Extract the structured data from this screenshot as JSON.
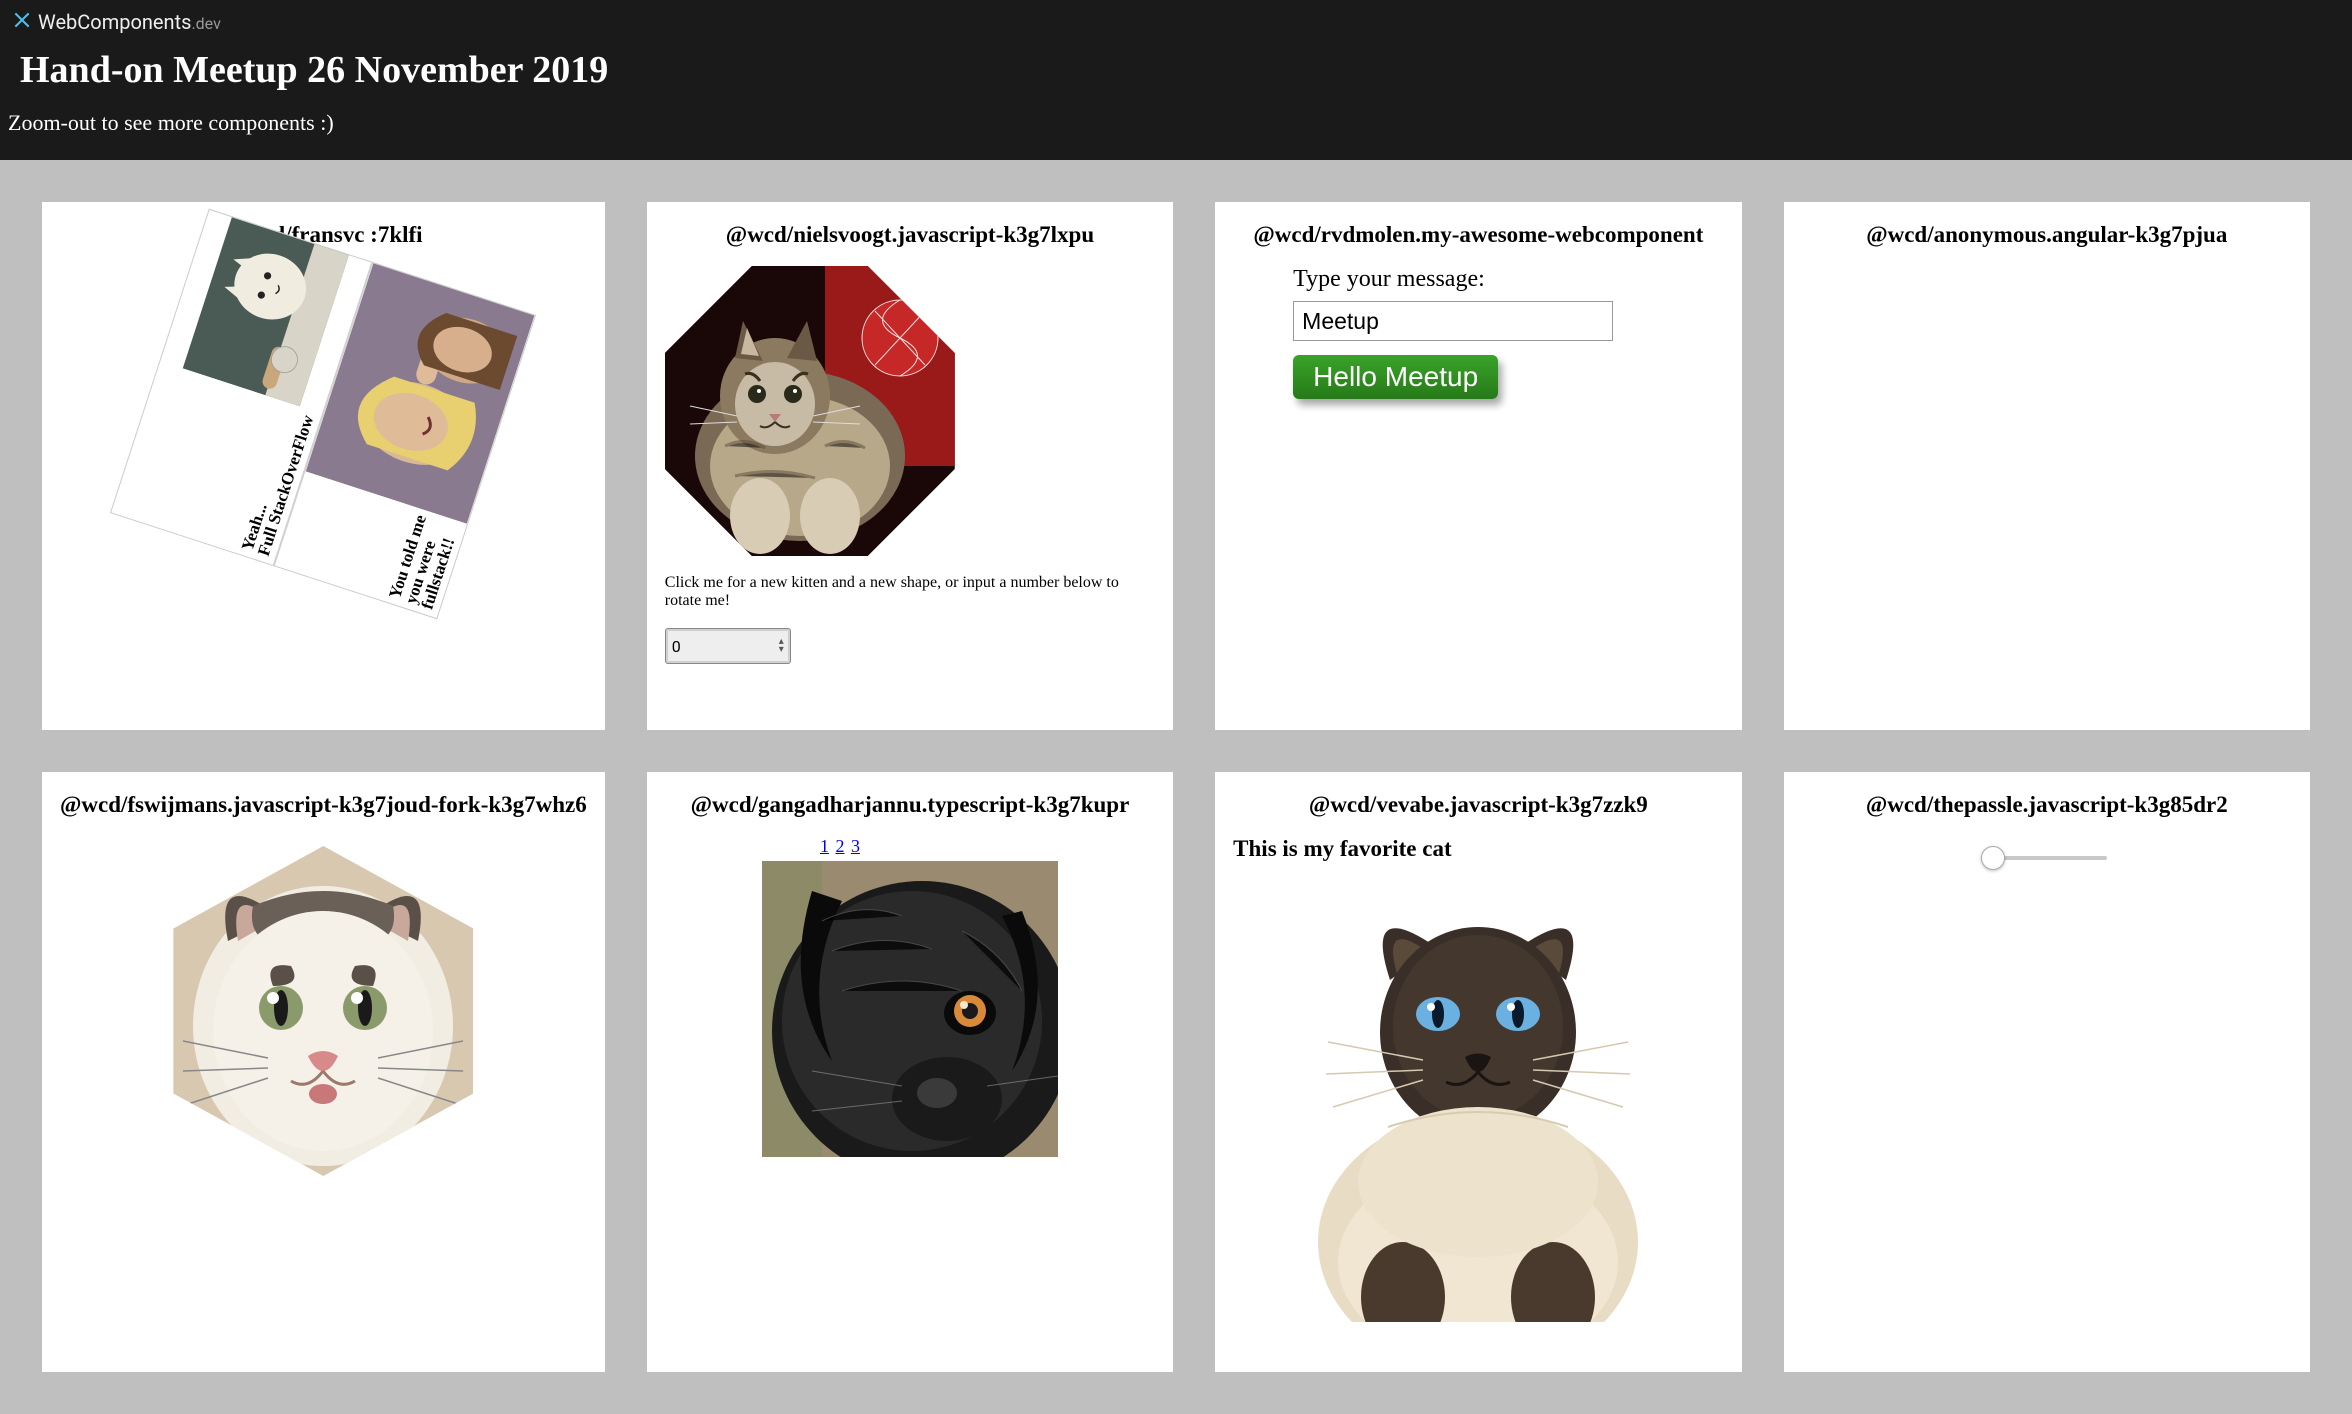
{
  "brand": {
    "name": "WebComponents",
    "suffix": ".dev"
  },
  "header": {
    "title": "Hand-on Meetup 26 November 2019",
    "subtitle": "Zoom-out to see more components :)"
  },
  "cards": [
    {
      "title": "@wcd/fransvc                :7klfi",
      "meme": {
        "topCaption": "Yeah...\nFull StackOverFlow",
        "bottomCaption": "You told me\nyou were\nfullstack!!"
      }
    },
    {
      "title": "@wcd/nielsvoogt.javascript-k3g7lxpu",
      "desc": "Click me for a new kitten and a new shape, or input a number below to rotate me!",
      "numberValue": "0"
    },
    {
      "title": "@wcd/rvdmolen.my-awesome-webcomponent",
      "label": "Type your message:",
      "inputValue": "Meetup",
      "greeting": "Hello Meetup"
    },
    {
      "title": "@wcd/anonymous.angular-k3g7pjua"
    },
    {
      "title": "@wcd/fswijmans.javascript-k3g7joud-fork-k3g7whz6"
    },
    {
      "title": "@wcd/gangadharjannu.typescript-k3g7kupr",
      "tabs": [
        "1",
        "2",
        "3"
      ]
    },
    {
      "title": "@wcd/vevabe.javascript-k3g7zzk9",
      "subheading": "This is my favorite cat"
    },
    {
      "title": "@wcd/thepassle.javascript-k3g85dr2"
    }
  ]
}
